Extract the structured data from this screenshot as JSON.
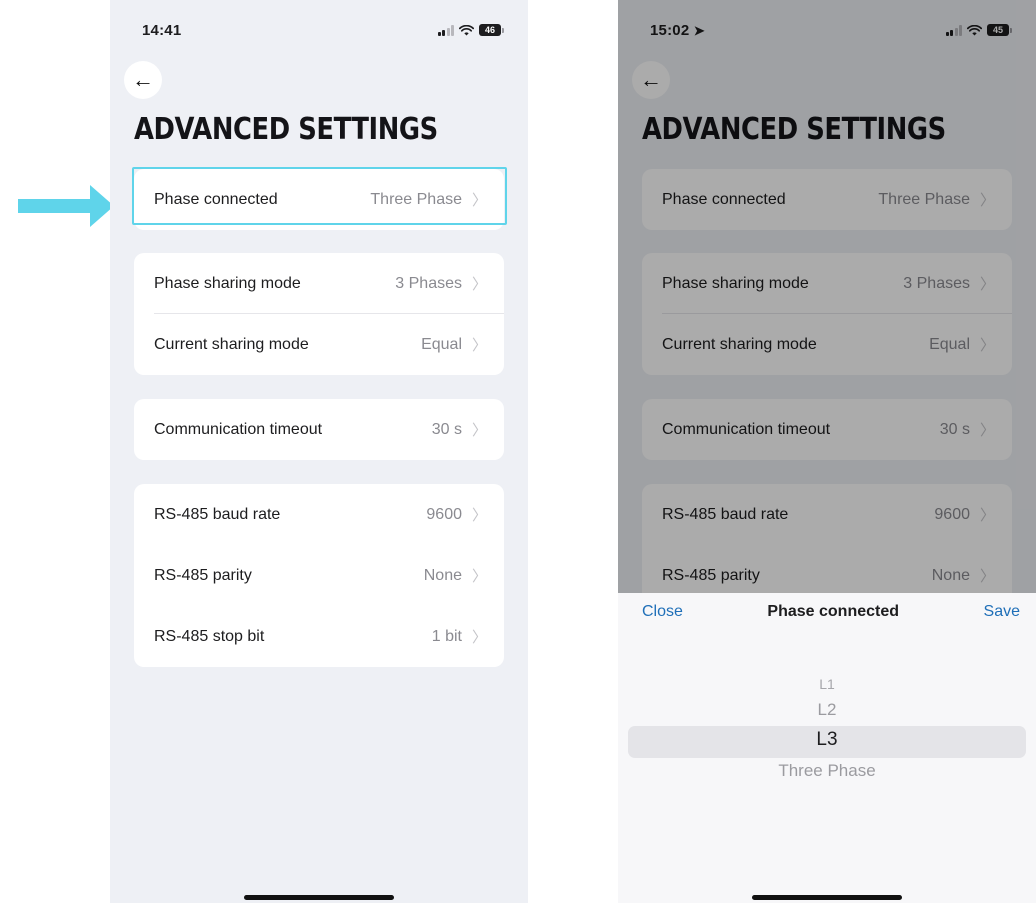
{
  "left": {
    "time": "14:41",
    "battery": "46",
    "title": "ADVANCED SETTINGS",
    "cards": [
      {
        "rows": [
          {
            "label": "Phase connected",
            "value": "Three Phase"
          }
        ]
      },
      {
        "rows": [
          {
            "label": "Phase sharing mode",
            "value": "3 Phases"
          },
          {
            "label": "Current sharing mode",
            "value": "Equal"
          }
        ]
      },
      {
        "rows": [
          {
            "label": "Communication timeout",
            "value": "30 s"
          }
        ]
      },
      {
        "rows": [
          {
            "label": "RS-485 baud rate",
            "value": "9600"
          },
          {
            "label": "RS-485 parity",
            "value": "None"
          },
          {
            "label": "RS-485 stop bit",
            "value": "1 bit"
          }
        ]
      }
    ]
  },
  "right": {
    "time": "15:02",
    "battery": "45",
    "title": "ADVANCED SETTINGS",
    "cards": [
      {
        "rows": [
          {
            "label": "Phase connected",
            "value": "Three Phase"
          }
        ]
      },
      {
        "rows": [
          {
            "label": "Phase sharing mode",
            "value": "3 Phases"
          },
          {
            "label": "Current sharing mode",
            "value": "Equal"
          }
        ]
      },
      {
        "rows": [
          {
            "label": "Communication timeout",
            "value": "30 s"
          }
        ]
      },
      {
        "rows": [
          {
            "label": "RS-485 baud rate",
            "value": "9600"
          },
          {
            "label": "RS-485 parity",
            "value": "None"
          }
        ]
      }
    ],
    "sheet": {
      "close_label": "Close",
      "title": "Phase connected",
      "save_label": "Save",
      "options": [
        "L1",
        "L2",
        "L3",
        "Three Phase"
      ],
      "selected": "L3"
    }
  },
  "colors": {
    "highlight": "#5fd4ea",
    "arrow": "#5fd4ea",
    "link": "#1f6fb8",
    "background": "#eef0f5"
  }
}
